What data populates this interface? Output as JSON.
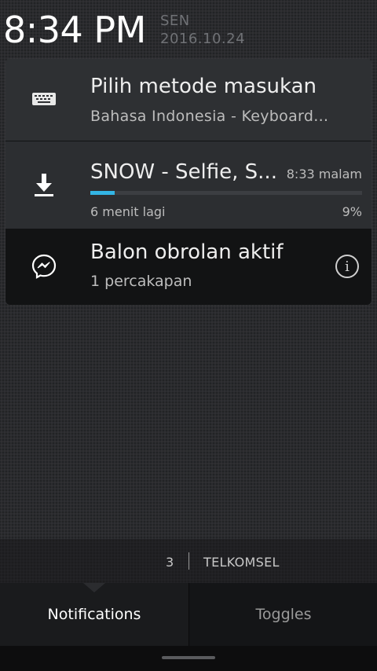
{
  "header": {
    "time": "8:34 PM",
    "day": "SEN",
    "date": "2016.10.24"
  },
  "notifications": [
    {
      "icon": "keyboard-icon",
      "title": "Pilih metode masukan",
      "subtitle": "Bahasa Indonesia - Keyboard…"
    },
    {
      "icon": "download-icon",
      "title": "SNOW - Selfie, S...",
      "time": "8:33 malam",
      "progress": 9,
      "eta": "6 menit lagi",
      "percent": "9%"
    },
    {
      "icon": "messenger-icon",
      "title": "Balon obrolan aktif",
      "subtitle": "1 percakapan",
      "info_icon": "info-icon"
    }
  ],
  "carrier": {
    "count": "3",
    "name": "TELKOMSEL"
  },
  "tabs": [
    {
      "label": "Notifications",
      "active": true
    },
    {
      "label": "Toggles",
      "active": false
    }
  ],
  "colors": {
    "accent": "#33b5e5"
  }
}
